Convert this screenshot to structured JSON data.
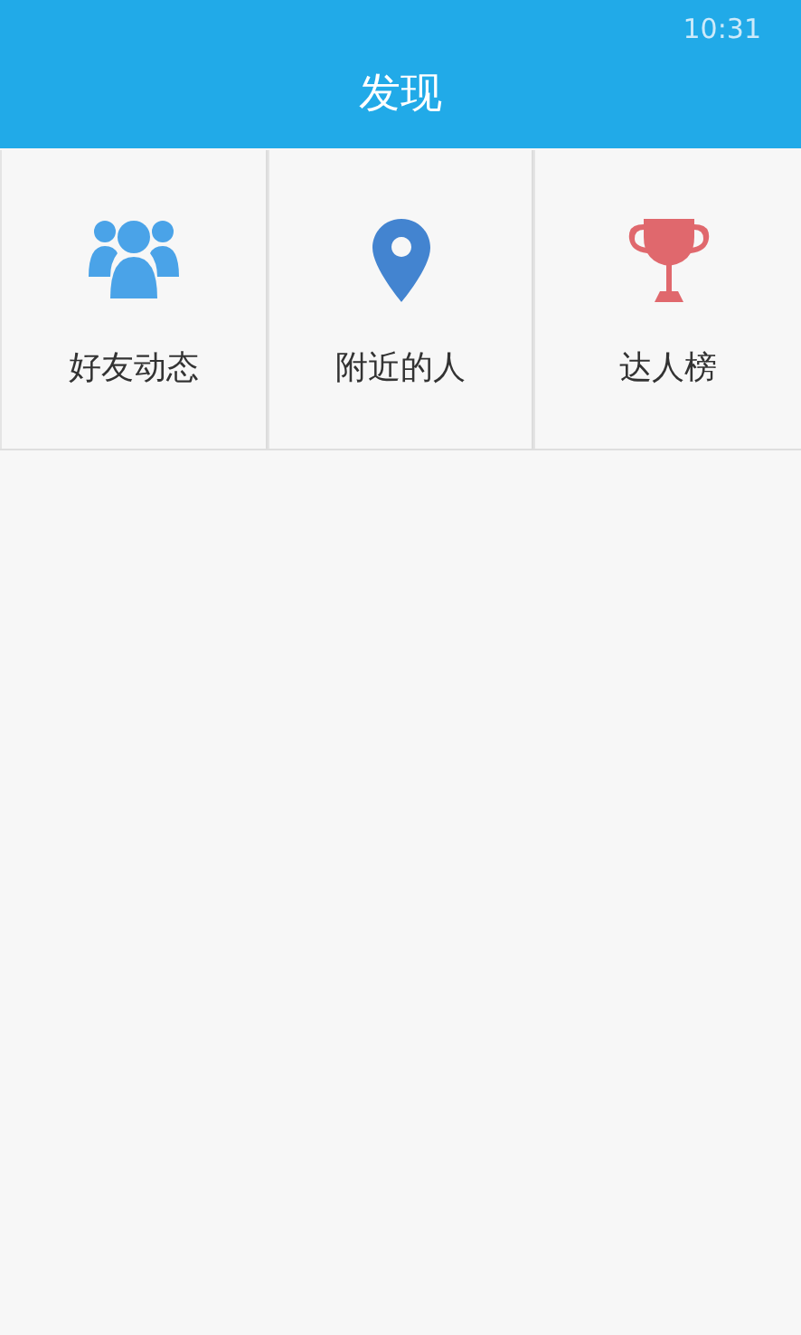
{
  "status_bar": {
    "time": "10:31"
  },
  "header": {
    "title": "发现"
  },
  "tiles": [
    {
      "kind": "friends",
      "label": "好友动态",
      "color": "#4aa3e8"
    },
    {
      "kind": "location",
      "label": "附近的人",
      "color": "#4384d0"
    },
    {
      "kind": "trophy",
      "label": "达人榜",
      "color": "#e0686d"
    }
  ]
}
